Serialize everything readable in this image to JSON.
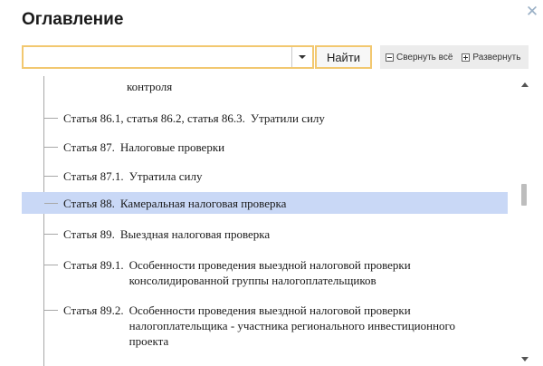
{
  "dialog": {
    "title": "Оглавление",
    "close_symbol": "✕"
  },
  "search": {
    "value": "",
    "placeholder": "",
    "find_label": "Найти"
  },
  "toolbar": {
    "collapse_label": "Свернуть всё",
    "expand_label": "Развернуть"
  },
  "tree": {
    "partial_top": "контроля",
    "items": [
      {
        "num": "Статья 86.1, статья 86.2, статья 86.3.",
        "title_lines": [
          "Утратили силу"
        ],
        "selected": false
      },
      {
        "num": "Статья 87.",
        "title_lines": [
          "Налоговые проверки"
        ],
        "selected": false
      },
      {
        "num": "Статья 87.1.",
        "title_lines": [
          "Утратила силу"
        ],
        "selected": false
      },
      {
        "num": "Статья 88.",
        "title_lines": [
          "Камеральная налоговая проверка"
        ],
        "selected": true
      },
      {
        "num": "Статья 89.",
        "title_lines": [
          "Выездная налоговая проверка"
        ],
        "selected": false
      },
      {
        "num": "Статья 89.1.",
        "title_lines": [
          "Особенности проведения выездной налоговой проверки",
          "консолидированной группы налогоплательщиков"
        ],
        "selected": false
      },
      {
        "num": "Статья 89.2.",
        "title_lines": [
          "Особенности проведения выездной налоговой проверки",
          "налогоплательщика - участника регионального инвестиционного",
          "проекта"
        ],
        "selected": false
      }
    ]
  }
}
